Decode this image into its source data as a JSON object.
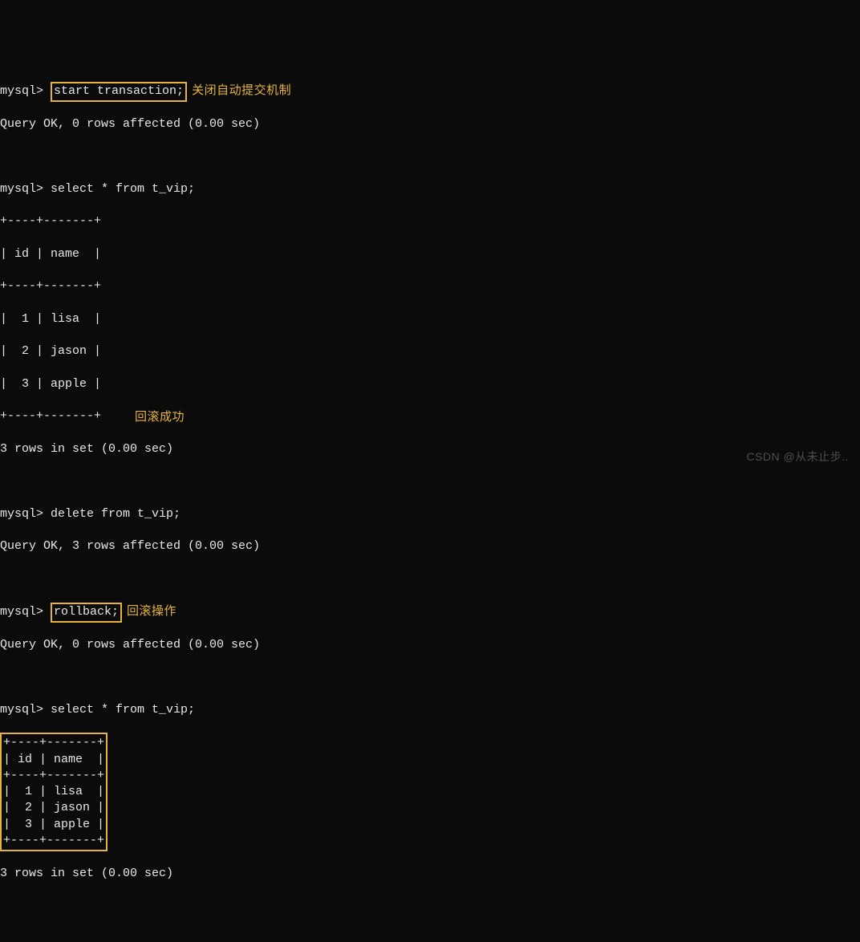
{
  "prompt": "mysql>",
  "cmd1": "start transaction;",
  "annot1": "关闭自动提交机制",
  "resp1": "Query OK, 0 rows affected (0.00 sec)",
  "cmd2": "select * from t_vip;",
  "table1_border_top": "+----+-------+",
  "table1_header": "| id | name  |",
  "table1_sep": "+----+-------+",
  "table1_rows": [
    "|  1 | lisa  |",
    "|  2 | jason |",
    "|  3 | apple |"
  ],
  "table1_border_bot": "+----+-------+",
  "resp2": "3 rows in set (0.00 sec)",
  "cmd3": "delete from t_vip;",
  "resp3": "Query OK, 3 rows affected (0.00 sec)",
  "cmd4": "rollback;",
  "annot4": "回滚操作",
  "resp4": "Query OK, 0 rows affected (0.00 sec)",
  "cmd5": "select * from t_vip;",
  "table2_lines": [
    "+----+-------+",
    "| id | name  |",
    "+----+-------+",
    "|  1 | lisa  |",
    "|  2 | jason |",
    "|  3 | apple |",
    "+----+-------+"
  ],
  "annot5": "回滚成功",
  "resp5": "3 rows in set (0.00 sec)",
  "watermark": "CSDN @从未止步.."
}
